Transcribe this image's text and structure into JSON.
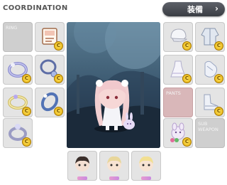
{
  "header": {
    "title": "COORDINATION",
    "equip_button": "装備",
    "equip_chevron": "›"
  },
  "slots": {
    "ring": "RING",
    "pants": "PANTS",
    "sub_weapon": "SUB\nWEAPON",
    "badge": "C"
  },
  "icons": {
    "card": "card-icon",
    "ring_item": "ring-icon",
    "necklace": "necklace-icon",
    "earring": "earring-icon",
    "belt": "belt-icon",
    "hat": "hat-icon",
    "coat": "coat-icon",
    "dress": "dress-icon",
    "glove": "glove-icon",
    "shoes": "shoes-icon",
    "doll": "doll-icon",
    "pet": "pet-icon"
  },
  "colors": {
    "accent": "#4a4d53",
    "slot_bg": "#e4e4e4",
    "empty_slot": "#cfcfcf",
    "pants_slot": "#d9b7b9",
    "coin": "#f1c232"
  }
}
